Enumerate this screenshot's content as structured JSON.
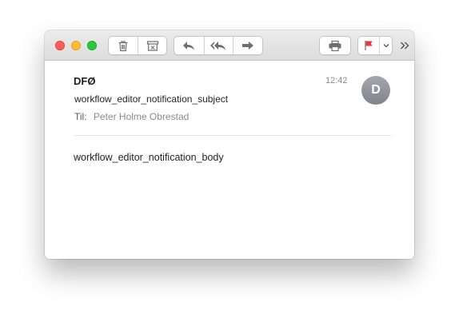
{
  "window": {
    "traffic_lights": {
      "close": "#fe5f57",
      "minimize": "#febc2e",
      "zoom": "#28c840"
    }
  },
  "toolbar": {
    "icons": {
      "delete": "trash-icon",
      "archive": "archive-icon",
      "reply": "reply-icon",
      "reply_all": "reply-all-icon",
      "forward": "forward-icon",
      "print": "print-icon",
      "flag": "flag-icon",
      "flag_menu": "chevron-down-icon",
      "more": "double-chevron-right-icon"
    },
    "flag_color": "#e8393a"
  },
  "message": {
    "sender": "DFØ",
    "time": "12:42",
    "avatar_initial": "D",
    "subject": "workflow_editor_notification_subject",
    "to_label": "Til:",
    "to_name": "Peter Holme Obrestad",
    "body": "workflow_editor_notification_body"
  }
}
